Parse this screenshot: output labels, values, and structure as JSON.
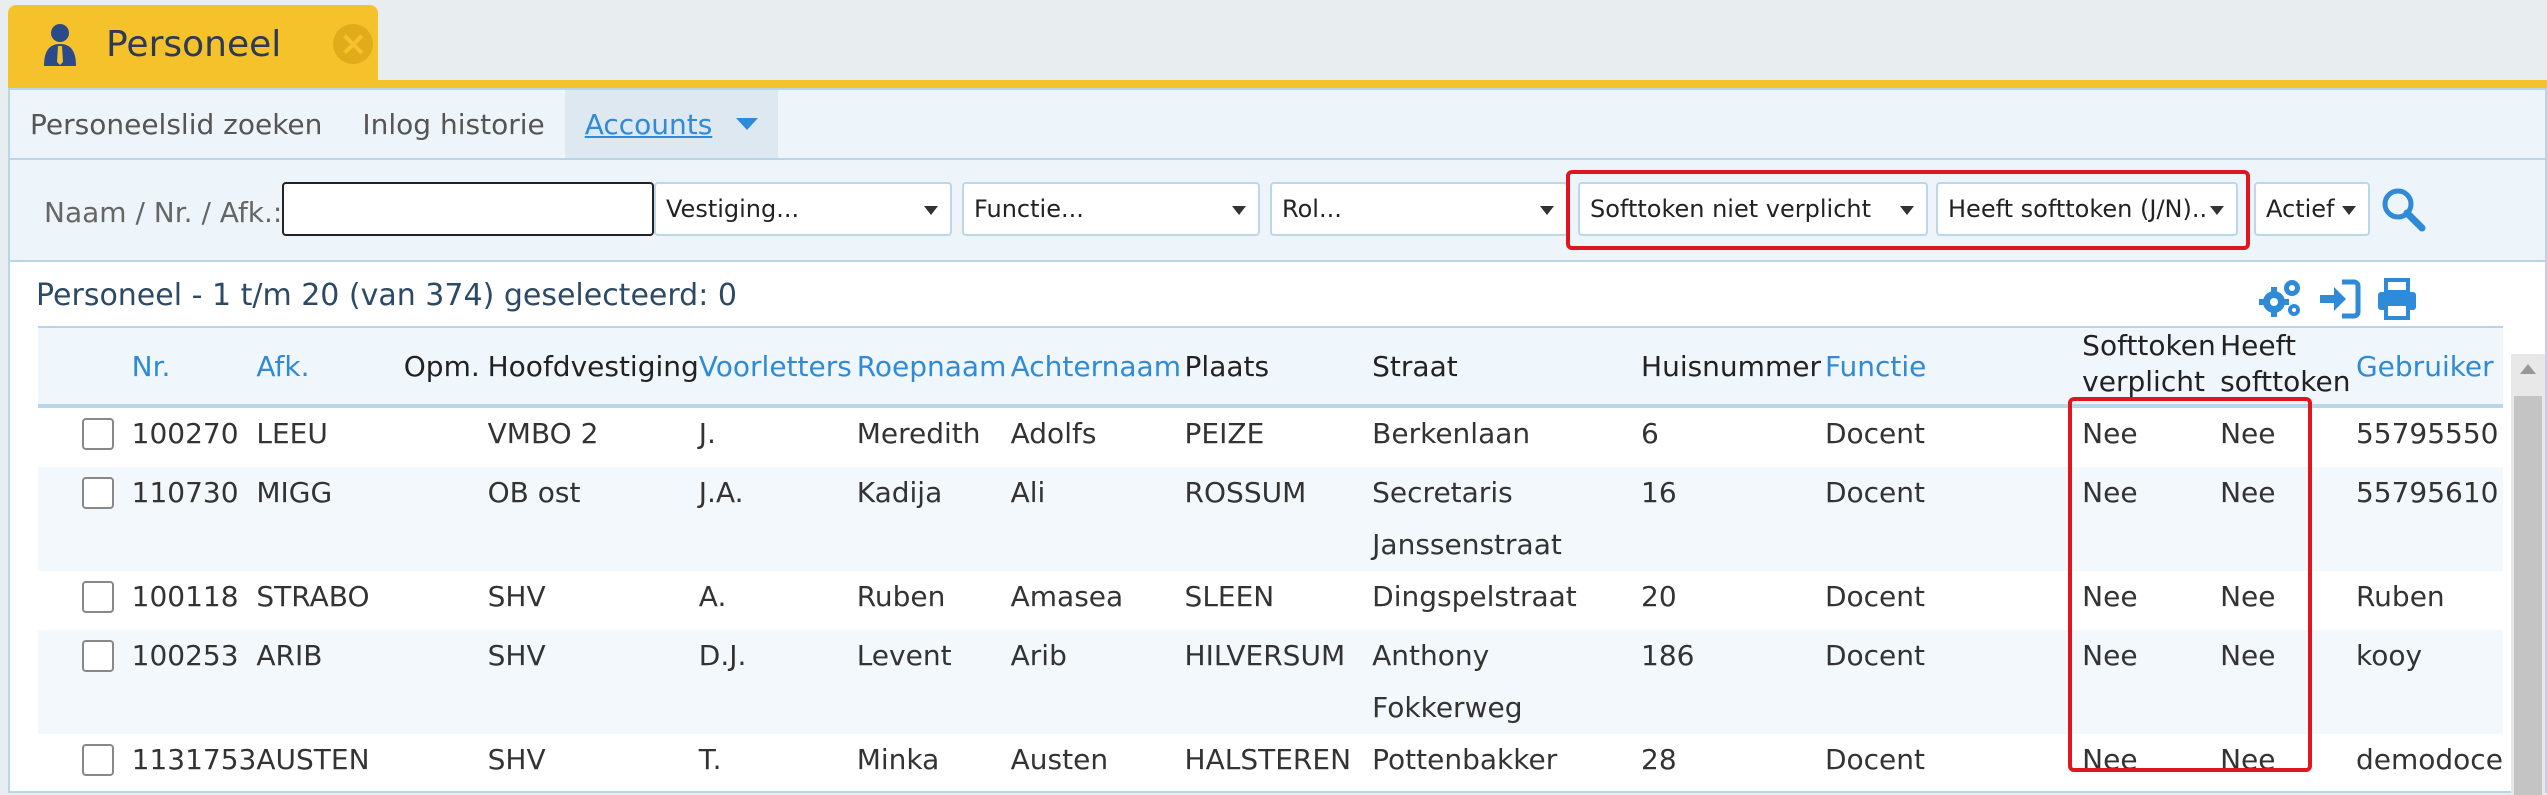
{
  "app_tab": {
    "title": "Personeel"
  },
  "subnav": {
    "items": [
      {
        "label": "Personeelslid zoeken"
      },
      {
        "label": "Inlog historie"
      },
      {
        "label": "Accounts"
      }
    ]
  },
  "filters": {
    "label": "Naam / Nr. / Afk.:",
    "search_value": "",
    "vestiging": "Vestiging...",
    "functie": "Functie...",
    "rol": "Rol...",
    "softtoken_verplicht": "Softtoken niet verplicht",
    "heeft_softtoken": "Heeft softtoken (J/N)..",
    "status": "Actief"
  },
  "list": {
    "title": "Personeel - 1 t/m 20 (van 374) geselecteerd: 0"
  },
  "columns": [
    {
      "label": "Nr."
    },
    {
      "label": "Afk."
    },
    {
      "label": "Opm."
    },
    {
      "label": "Hoofdvestiging"
    },
    {
      "label": "Voorletters"
    },
    {
      "label": "Roepnaam"
    },
    {
      "label": "Achternaam"
    },
    {
      "label": "Plaats"
    },
    {
      "label": "Straat"
    },
    {
      "label": "Huisnummer"
    },
    {
      "label": "Functie"
    },
    {
      "label": "Softtoken verplicht"
    },
    {
      "label": "Heeft softtoken"
    },
    {
      "label": "Gebruiker"
    }
  ],
  "rows": [
    {
      "nr": "100270",
      "afk": "LEEU",
      "opm": "",
      "hoofdvestiging": "VMBO 2",
      "voorletters": "J.",
      "roepnaam": "Meredith",
      "achternaam": "Adolfs",
      "plaats": "PEIZE",
      "straat": "Berkenlaan",
      "huisnummer": "6",
      "functie": "Docent",
      "softtoken_verplicht": "Nee",
      "heeft_softtoken": "Nee",
      "gebruiker": "55795550"
    },
    {
      "nr": "110730",
      "afk": "MIGG",
      "opm": "",
      "hoofdvestiging": "OB ost",
      "voorletters": "J.A.",
      "roepnaam": "Kadija",
      "achternaam": "Ali",
      "plaats": "ROSSUM",
      "straat": "Secretaris Janssenstraat",
      "huisnummer": "16",
      "functie": "Docent",
      "softtoken_verplicht": "Nee",
      "heeft_softtoken": "Nee",
      "gebruiker": "55795610"
    },
    {
      "nr": "100118",
      "afk": "STRABO",
      "opm": "",
      "hoofdvestiging": "SHV",
      "voorletters": "A.",
      "roepnaam": "Ruben",
      "achternaam": "Amasea",
      "plaats": "SLEEN",
      "straat": "Dingspelstraat",
      "huisnummer": "20",
      "functie": "Docent",
      "softtoken_verplicht": "Nee",
      "heeft_softtoken": "Nee",
      "gebruiker": "Ruben"
    },
    {
      "nr": "100253",
      "afk": "ARIB",
      "opm": "",
      "hoofdvestiging": "SHV",
      "voorletters": "D.J.",
      "roepnaam": "Levent",
      "achternaam": "Arib",
      "plaats": "HILVERSUM",
      "straat": "Anthony Fokkerweg",
      "huisnummer": "186",
      "functie": "Docent",
      "softtoken_verplicht": "Nee",
      "heeft_softtoken": "Nee",
      "gebruiker": "kooy"
    },
    {
      "nr": "1131753",
      "afk": "AUSTEN",
      "opm": "",
      "hoofdvestiging": "SHV",
      "voorletters": "T.",
      "roepnaam": "Minka",
      "achternaam": "Austen",
      "plaats": "HALSTEREN",
      "straat": "Pottenbakker",
      "huisnummer": "28",
      "functie": "Docent",
      "softtoken_verplicht": "Nee",
      "heeft_softtoken": "Nee",
      "gebruiker": "demodoce"
    }
  ]
}
